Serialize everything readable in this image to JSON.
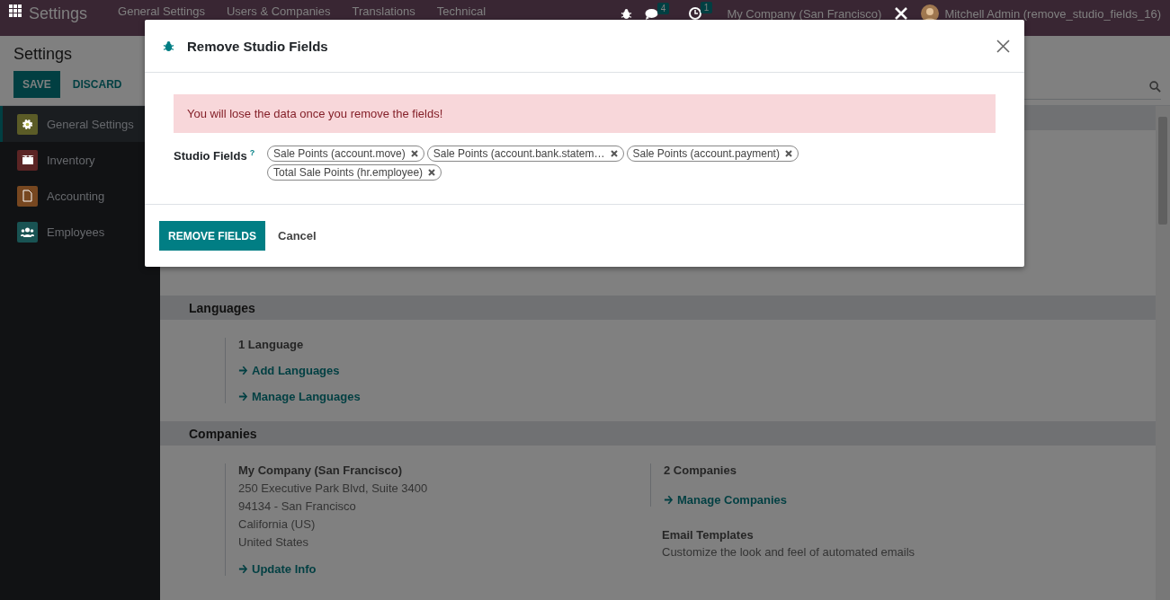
{
  "navbar": {
    "app_name": "Settings",
    "menu": [
      "General Settings",
      "Users & Companies",
      "Translations",
      "Technical"
    ],
    "messages_count": "4",
    "activities_count": "1",
    "company": "My Company (San Francisco)",
    "user": "Mitchell Admin (remove_studio_fields_16)"
  },
  "control_panel": {
    "title": "Settings",
    "buttons": [
      {
        "label": "SAVE",
        "kind": "primary"
      },
      {
        "label": "DISCARD",
        "kind": "secondary"
      }
    ]
  },
  "sidebar": {
    "items": [
      {
        "label": "General Settings",
        "selected": true,
        "color": "#5b5c27"
      },
      {
        "label": "Inventory",
        "selected": false,
        "color": "#5b2424"
      },
      {
        "label": "Accounting",
        "selected": false,
        "color": "#774720"
      },
      {
        "label": "Employees",
        "selected": false,
        "color": "#195353"
      }
    ]
  },
  "sections": [
    {
      "title": "Languages",
      "kind": "languages",
      "count": "1 Language",
      "links": [
        "Add Languages",
        "Manage Languages"
      ]
    },
    {
      "title": "Companies",
      "kind": "companies",
      "company": {
        "name": "My Company (San Francisco)",
        "address": [
          "250 Executive Park Blvd, Suite 3400",
          "94134 - San Francisco",
          "California (US)",
          "United States"
        ],
        "link": "Update Info"
      },
      "companies_count": "2 Companies",
      "companies_link": "Manage Companies",
      "templates": {
        "title": "Email Templates",
        "description": "Customize the look and feel of automated emails"
      }
    }
  ],
  "dialog": {
    "title": "Remove Studio Fields",
    "alert": "You will lose the data once you remove the fields!",
    "field_label": "Studio Fields",
    "help": "?",
    "tags": [
      "Sale Points (account.move)",
      "Sale Points (account.bank.statem…",
      "Sale Points (account.payment)",
      "Total Sale Points (hr.employee)"
    ],
    "buttons": [
      {
        "label": "REMOVE FIELDS",
        "kind": "primary"
      },
      {
        "label": "Cancel",
        "kind": "secondary"
      }
    ]
  }
}
